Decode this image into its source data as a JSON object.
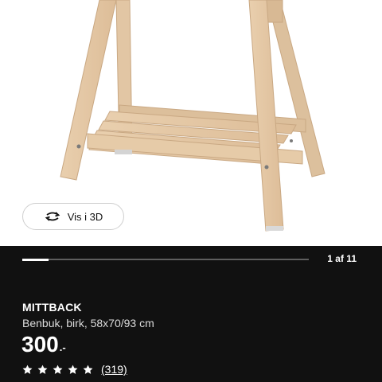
{
  "gallery": {
    "view_3d_label": "Vis i 3D",
    "counter": "1 af 11",
    "current_index": 1,
    "total_images": 11
  },
  "product": {
    "name": "MITTBACK",
    "description": "Benbuk, birk, 58x70/93 cm",
    "price": "300",
    "price_suffix": ".-",
    "rating_stars": 5,
    "review_count": "(319)"
  },
  "colors": {
    "background_dark": "#111111",
    "image_background": "#ffffff",
    "text_primary": "#ffffff",
    "progress_track": "#5e5e5e",
    "wood": "#e4c7a3"
  },
  "icons": {
    "view_3d": "rotate-3d-icon",
    "star": "star-icon"
  }
}
